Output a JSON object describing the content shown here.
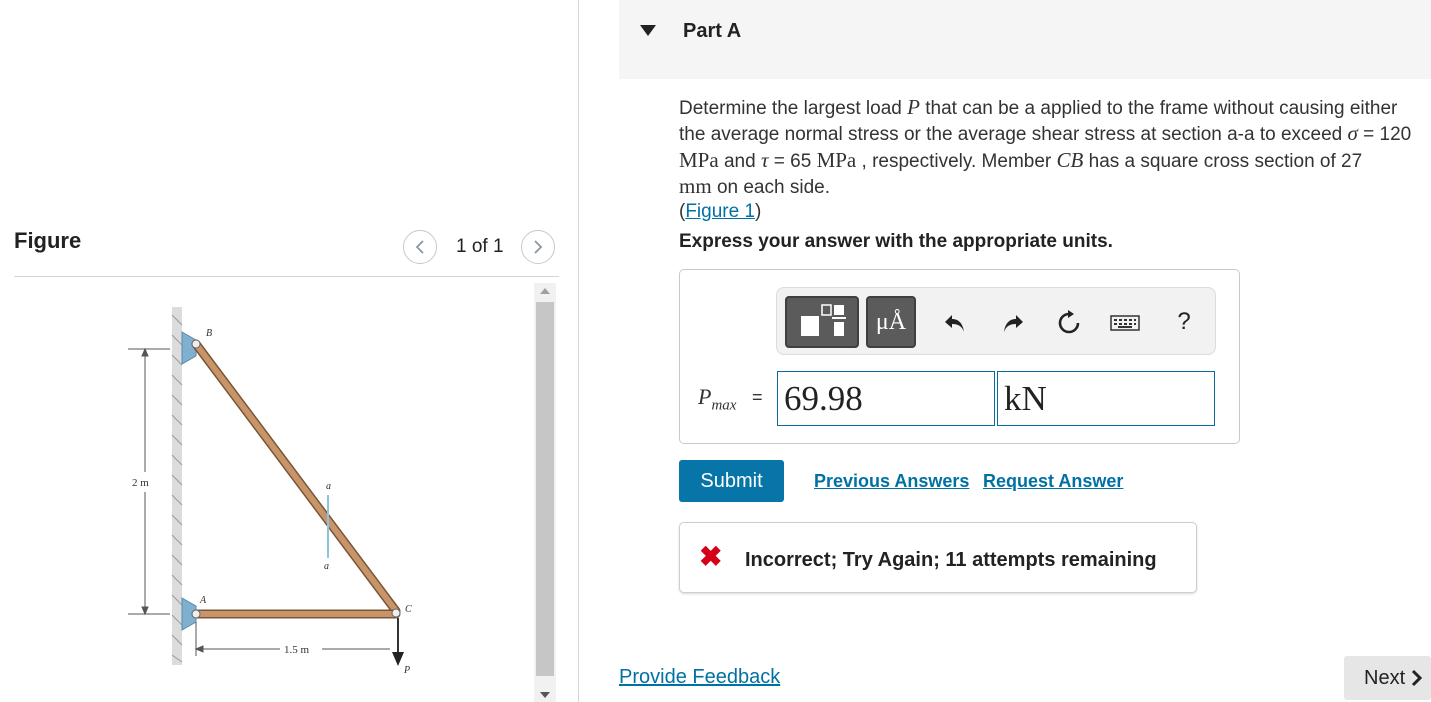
{
  "figure_panel": {
    "title": "Figure",
    "count": "1 of 1",
    "prev_icon": "chevron-left-icon",
    "next_icon": "chevron-right-icon",
    "diagram": {
      "label_B": "B",
      "label_A": "A",
      "label_C": "C",
      "label_P": "P",
      "label_a_top": "a",
      "label_a_bottom": "a",
      "dim_height": "2 m",
      "dim_width": "1.5 m"
    }
  },
  "part": {
    "title": "Part A",
    "toggle_icon": "caret-down-icon"
  },
  "question": {
    "line1_a": "Determine the largest load ",
    "line1_P": "P",
    "line1_b": " that can be a applied to the frame without causing either",
    "line2_a": "the average normal stress or the average shear stress at section a-a to exceed ",
    "line2_sigma": "σ",
    "line2_b": " = 120",
    "line3_MPa1": "MPa",
    "line3_a": " and ",
    "line3_tau": "τ",
    "line3_b": " = 65 ",
    "line3_MPa2": "MPa",
    "line3_c": " , respectively. Member ",
    "line3_CB": "CB",
    "line3_d": " has a square cross section of 27",
    "line4_mm": "mm",
    "line4_a": " on each side.",
    "figure_link_open": "(",
    "figure_link": "Figure 1",
    "figure_link_close": ")"
  },
  "instructions": "Express your answer with the appropriate units.",
  "toolbar": {
    "templates_icon": "templates-icon",
    "units_label": "μÅ",
    "undo_icon": "undo-icon",
    "redo_icon": "redo-icon",
    "reset_icon": "reset-icon",
    "keyboard_icon": "keyboard-icon",
    "help_label": "?"
  },
  "answer": {
    "var_main": "P",
    "var_sub": "max",
    "equals": "=",
    "value": "69.98",
    "units": "kN"
  },
  "actions": {
    "submit": "Submit",
    "previous_answers": "Previous Answers",
    "request_answer": "Request Answer"
  },
  "feedback": {
    "icon": "x-icon",
    "mark": "✖",
    "text": "Incorrect; Try Again; 11 attempts remaining"
  },
  "footer": {
    "provide_feedback": "Provide Feedback",
    "next": "Next"
  },
  "colors": {
    "link": "#0071a5",
    "submit_bg": "#0875a8",
    "error": "#d4001a",
    "member": "#c8956a",
    "support": "#7fb0cf"
  }
}
